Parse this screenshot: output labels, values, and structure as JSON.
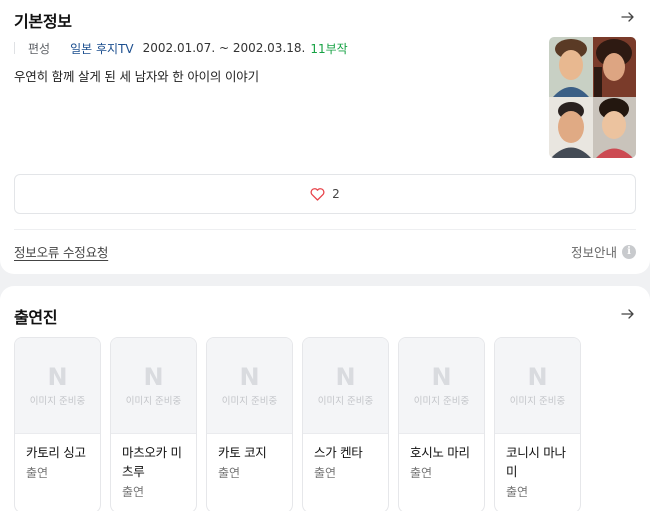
{
  "basic_info": {
    "title": "기본정보",
    "meta_label": "편성",
    "network": "일본 후지TV",
    "dates": "2002.01.07. ~ 2002.03.18.",
    "episodes": "11부작",
    "description": "우연히 함께 살게 된 세 남자와 한 아이의 이야기",
    "like_count": "2",
    "report_link": "정보오류 수정요청",
    "info_guide": "정보안내"
  },
  "cast_section": {
    "title": "출연진",
    "placeholder_logo": "N",
    "placeholder_text": "이미지 준비중",
    "members": [
      {
        "name": "카토리 싱고",
        "role": "출연"
      },
      {
        "name": "마츠오카 미츠루",
        "role": "출연"
      },
      {
        "name": "카토 코지",
        "role": "출연"
      },
      {
        "name": "스가 켄타",
        "role": "출연"
      },
      {
        "name": "호시노 마리",
        "role": "출연"
      },
      {
        "name": "코니시 마나미",
        "role": "출연"
      }
    ]
  },
  "colors": {
    "network": "#1c4f8f",
    "episodes": "#17a244",
    "heart": "#e8444b"
  },
  "icons": {
    "section_arrow": "arrow-right-icon",
    "like": "heart-icon",
    "info": "info-circle-icon"
  }
}
